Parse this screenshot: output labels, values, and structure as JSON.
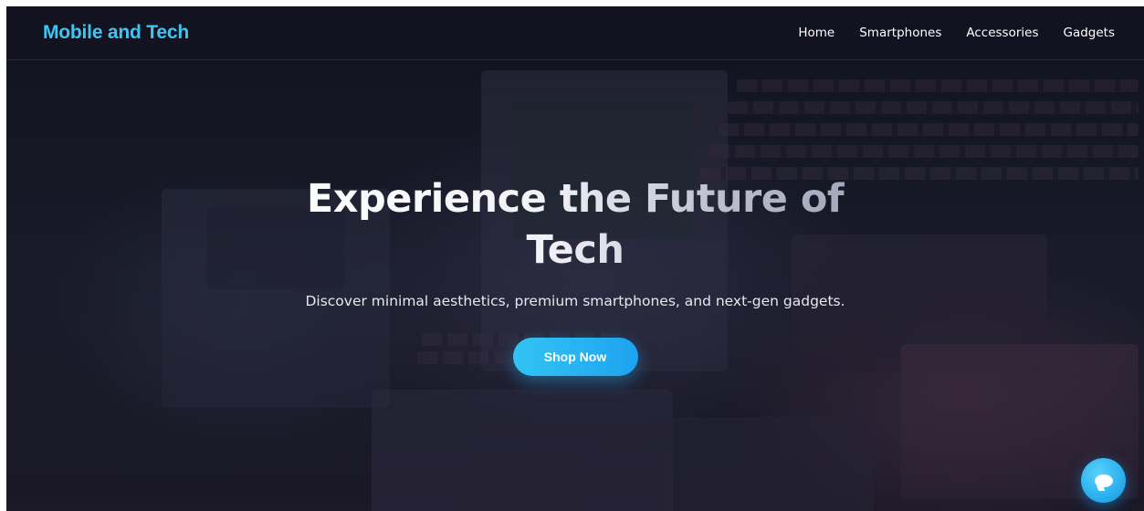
{
  "site": {
    "brand": "Mobile and Tech",
    "accent_color": "#3ec6f2"
  },
  "nav": {
    "items": [
      {
        "label": "Home"
      },
      {
        "label": "Smartphones"
      },
      {
        "label": "Accessories"
      },
      {
        "label": "Gadgets"
      }
    ]
  },
  "hero": {
    "title": "Experience the Future of Tech",
    "subtitle": "Discover minimal aesthetics, premium smartphones, and next-gen gadgets.",
    "cta_label": "Shop Now",
    "background": "retro-computers-photo"
  },
  "chat": {
    "icon": "chat-bubble-icon"
  }
}
